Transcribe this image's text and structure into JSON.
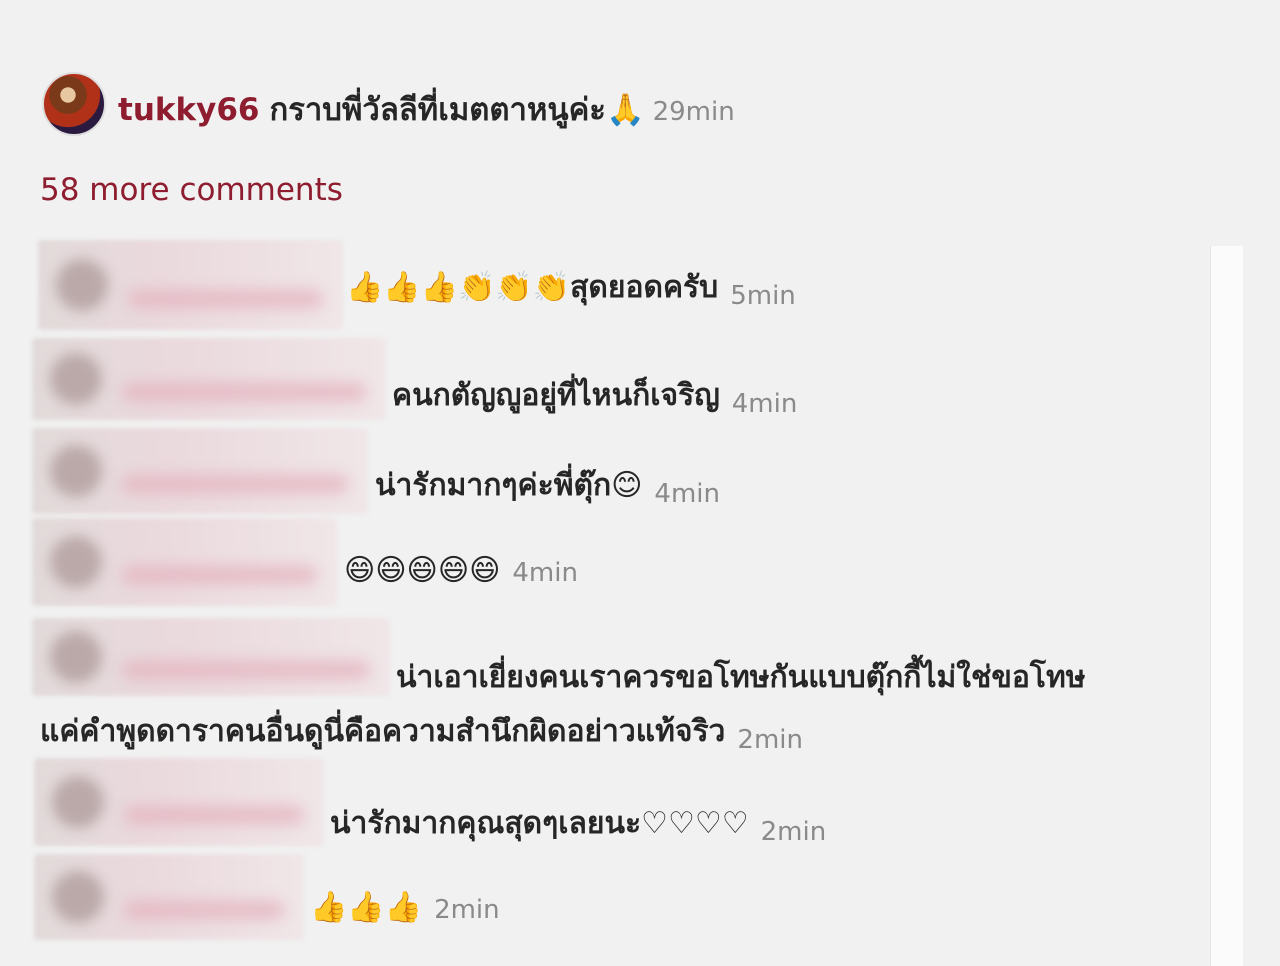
{
  "post_comment": {
    "username": "tukky66",
    "text": "กราบพี่วัลลีที่เมตตาหนูค่ะ🙏",
    "time": "29min"
  },
  "more_comments_label": "58 more comments",
  "comments": [
    {
      "text": "👍👍👍👏👏👏สุดยอดครับ",
      "time": "5min"
    },
    {
      "text": "คนกตัญญูอยู่ที่ไหนก็เจริญ",
      "time": "4min"
    },
    {
      "text": "น่ารักมากๆค่ะพี่ตุ๊ก😊",
      "time": "4min"
    },
    {
      "text": "😄😄😄😄😄",
      "time": "4min"
    },
    {
      "text": "น่าเอาเยี่ยงคนเราควรขอโทษกันแบบตุ๊กกี้ไม่ใช่ขอโทษ",
      "text2": "แค่คำพูดดาราคนอื่นดูนี่คือความสำนึกผิดอย่าวแท้จริว",
      "time": "2min"
    },
    {
      "text": "น่ารักมากคุณสุดๆเลยนะ♡♡♡♡",
      "time": "2min"
    },
    {
      "text": "👍👍👍",
      "time": "2min"
    }
  ]
}
